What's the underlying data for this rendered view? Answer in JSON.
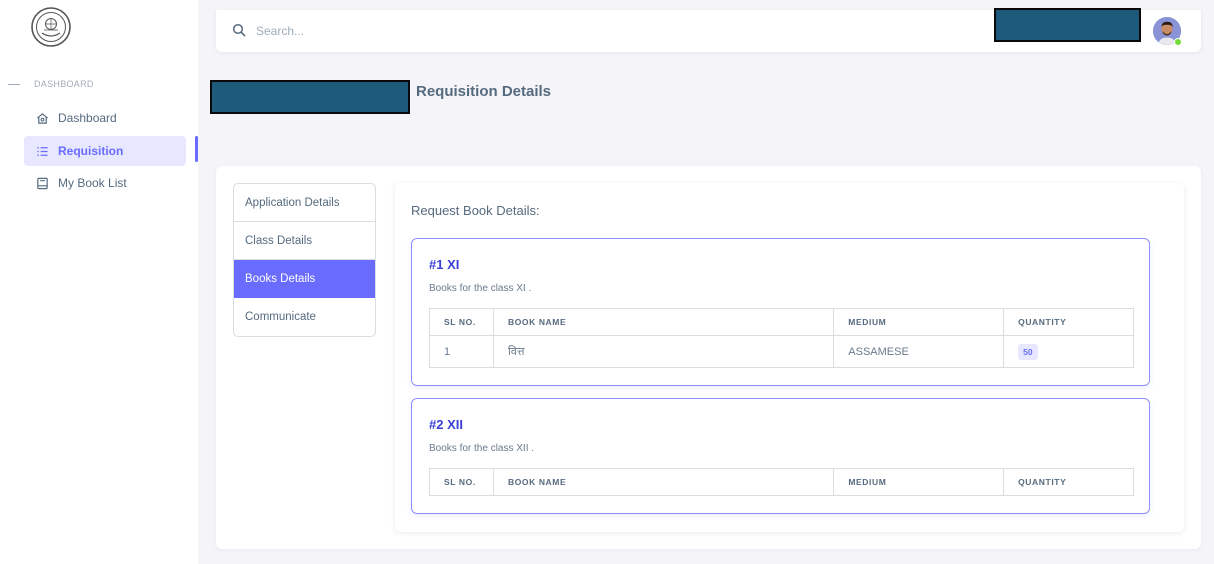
{
  "sidebar": {
    "logo": "institution-seal",
    "section_header": "DASHBOARD",
    "items": [
      {
        "label": "Dashboard",
        "icon": "home-icon"
      },
      {
        "label": "Requisition",
        "icon": "list-icon",
        "active": true
      },
      {
        "label": "My Book List",
        "icon": "book-icon"
      }
    ]
  },
  "topbar": {
    "search_placeholder": "Search...",
    "search_value": ""
  },
  "page": {
    "title": "Requisition Details"
  },
  "tabs": [
    {
      "label": "Application Details"
    },
    {
      "label": "Class Details"
    },
    {
      "label": "Books Details",
      "active": true
    },
    {
      "label": "Communicate"
    }
  ],
  "books": {
    "heading": "Request Book Details:",
    "columns": [
      "SL NO.",
      "BOOK NAME",
      "MEDIUM",
      "QUANTITY"
    ],
    "classes": [
      {
        "title": "#1 XI",
        "description": "Books for the class XI .",
        "rows": [
          {
            "sl": "1",
            "book": "वित्त",
            "medium": "ASSAMESE",
            "quantity": "50"
          }
        ]
      },
      {
        "title": "#2 XII",
        "description": "Books for the class XII .",
        "rows": []
      }
    ]
  },
  "colors": {
    "primary": "#696cff",
    "primary_light": "#e7e7ff",
    "text": "#566a7f",
    "background": "#f5f5f9",
    "redaction": "#1d5a7b",
    "online": "#71dd37"
  }
}
